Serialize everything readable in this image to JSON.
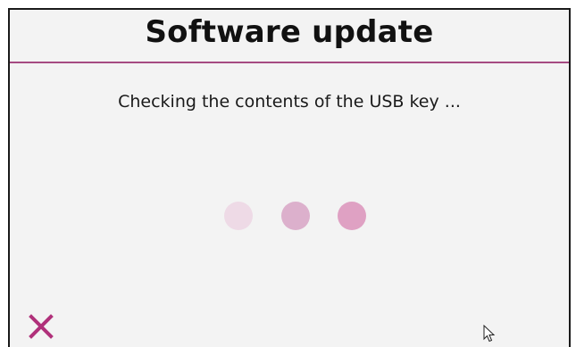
{
  "dialog": {
    "title": "Software update",
    "message": "Checking the contents of the USB key ...",
    "accent_color": "#a54a82",
    "close_icon": "close-icon"
  },
  "loading_indicator": {
    "dot_count": 3,
    "dot_colors": [
      "#eedae6",
      "#dcb0cc",
      "#dfa1c3"
    ]
  }
}
